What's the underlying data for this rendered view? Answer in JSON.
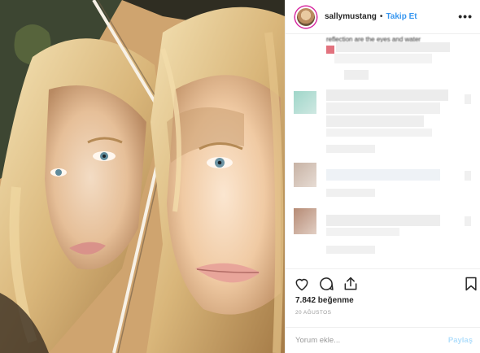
{
  "header": {
    "username": "sallymustang",
    "separator": "•",
    "follow_label": "Takip Et",
    "more_glyph": "•••"
  },
  "comments": {
    "partial_text": "reflection are the eyes and water"
  },
  "actions": {
    "like_icon": "heart-icon",
    "comment_icon": "comment-bubble-icon",
    "share_icon": "share-icon",
    "save_icon": "bookmark-icon"
  },
  "likes_text": "7.842 beğenme",
  "date_text": "20 AĞUSTOS",
  "comment_box": {
    "placeholder": "Yorum ekle...",
    "submit_label": "Paylaş"
  },
  "colors": {
    "accent": "#3897f0",
    "disabled_accent": "#b2dffc",
    "border": "#efefef",
    "muted": "#999999"
  }
}
